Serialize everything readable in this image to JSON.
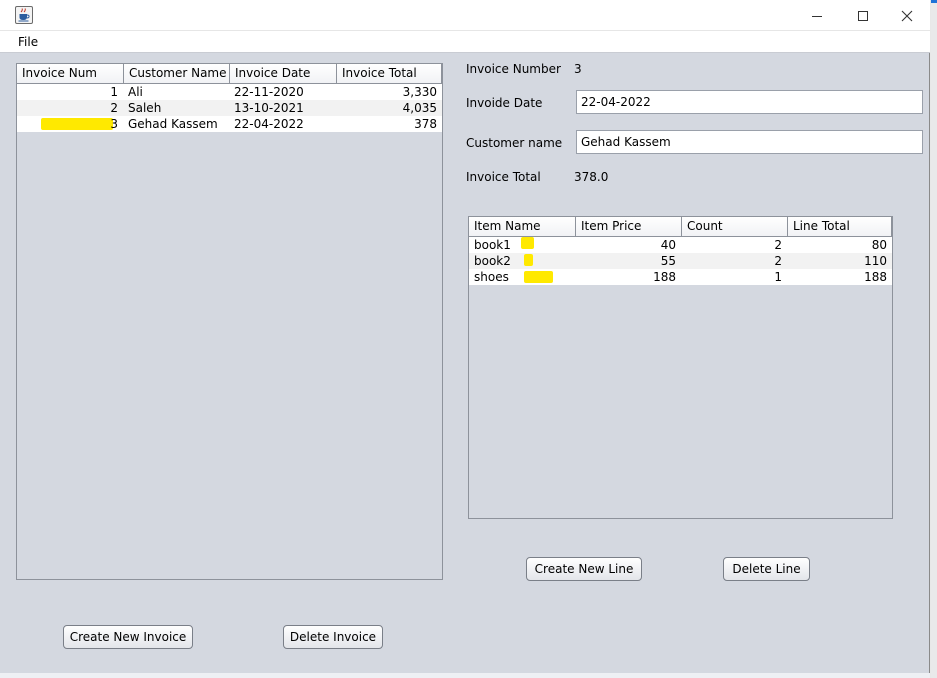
{
  "window": {
    "title": "",
    "menu": {
      "file": "File"
    }
  },
  "icons": {
    "app": "java-coffee-icon",
    "minimize": "minimize-icon",
    "maximize": "maximize-icon",
    "close": "close-icon"
  },
  "invoices_table": {
    "columns": [
      "Invoice Num",
      "Customer Name",
      "Invoice Date",
      "Invoice Total"
    ],
    "rows": [
      {
        "num": "1",
        "customer": "Ali",
        "date": "22-11-2020",
        "total": "3,330"
      },
      {
        "num": "2",
        "customer": "Saleh",
        "date": "13-10-2021",
        "total": "4,035"
      },
      {
        "num": "3",
        "customer": "Gehad Kassem",
        "date": "22-04-2022",
        "total": "378"
      }
    ]
  },
  "invoice_form": {
    "number_label": "Invoice Number",
    "number_value": "3",
    "date_label": "Invoide Date",
    "date_value": "22-04-2022",
    "customer_label": "Customer name",
    "customer_value": "Gehad Kassem",
    "total_label": "Invoice Total",
    "total_value": "378.0"
  },
  "lines_table": {
    "columns": [
      "Item Name",
      "Item Price",
      "Count",
      "Line Total"
    ],
    "rows": [
      {
        "item": "book1",
        "price": "40",
        "count": "2",
        "total": "80"
      },
      {
        "item": "book2",
        "price": "55",
        "count": "2",
        "total": "110"
      },
      {
        "item": "shoes",
        "price": "188",
        "count": "1",
        "total": "188"
      }
    ]
  },
  "buttons": {
    "create_invoice": "Create New Invoice",
    "delete_invoice": "Delete Invoice",
    "create_line": "Create New Line",
    "delete_line": "Delete Line"
  },
  "colors": {
    "panel_bg": "#d4d8e0",
    "highlight": "#ffe900",
    "border": "#8d929b"
  }
}
